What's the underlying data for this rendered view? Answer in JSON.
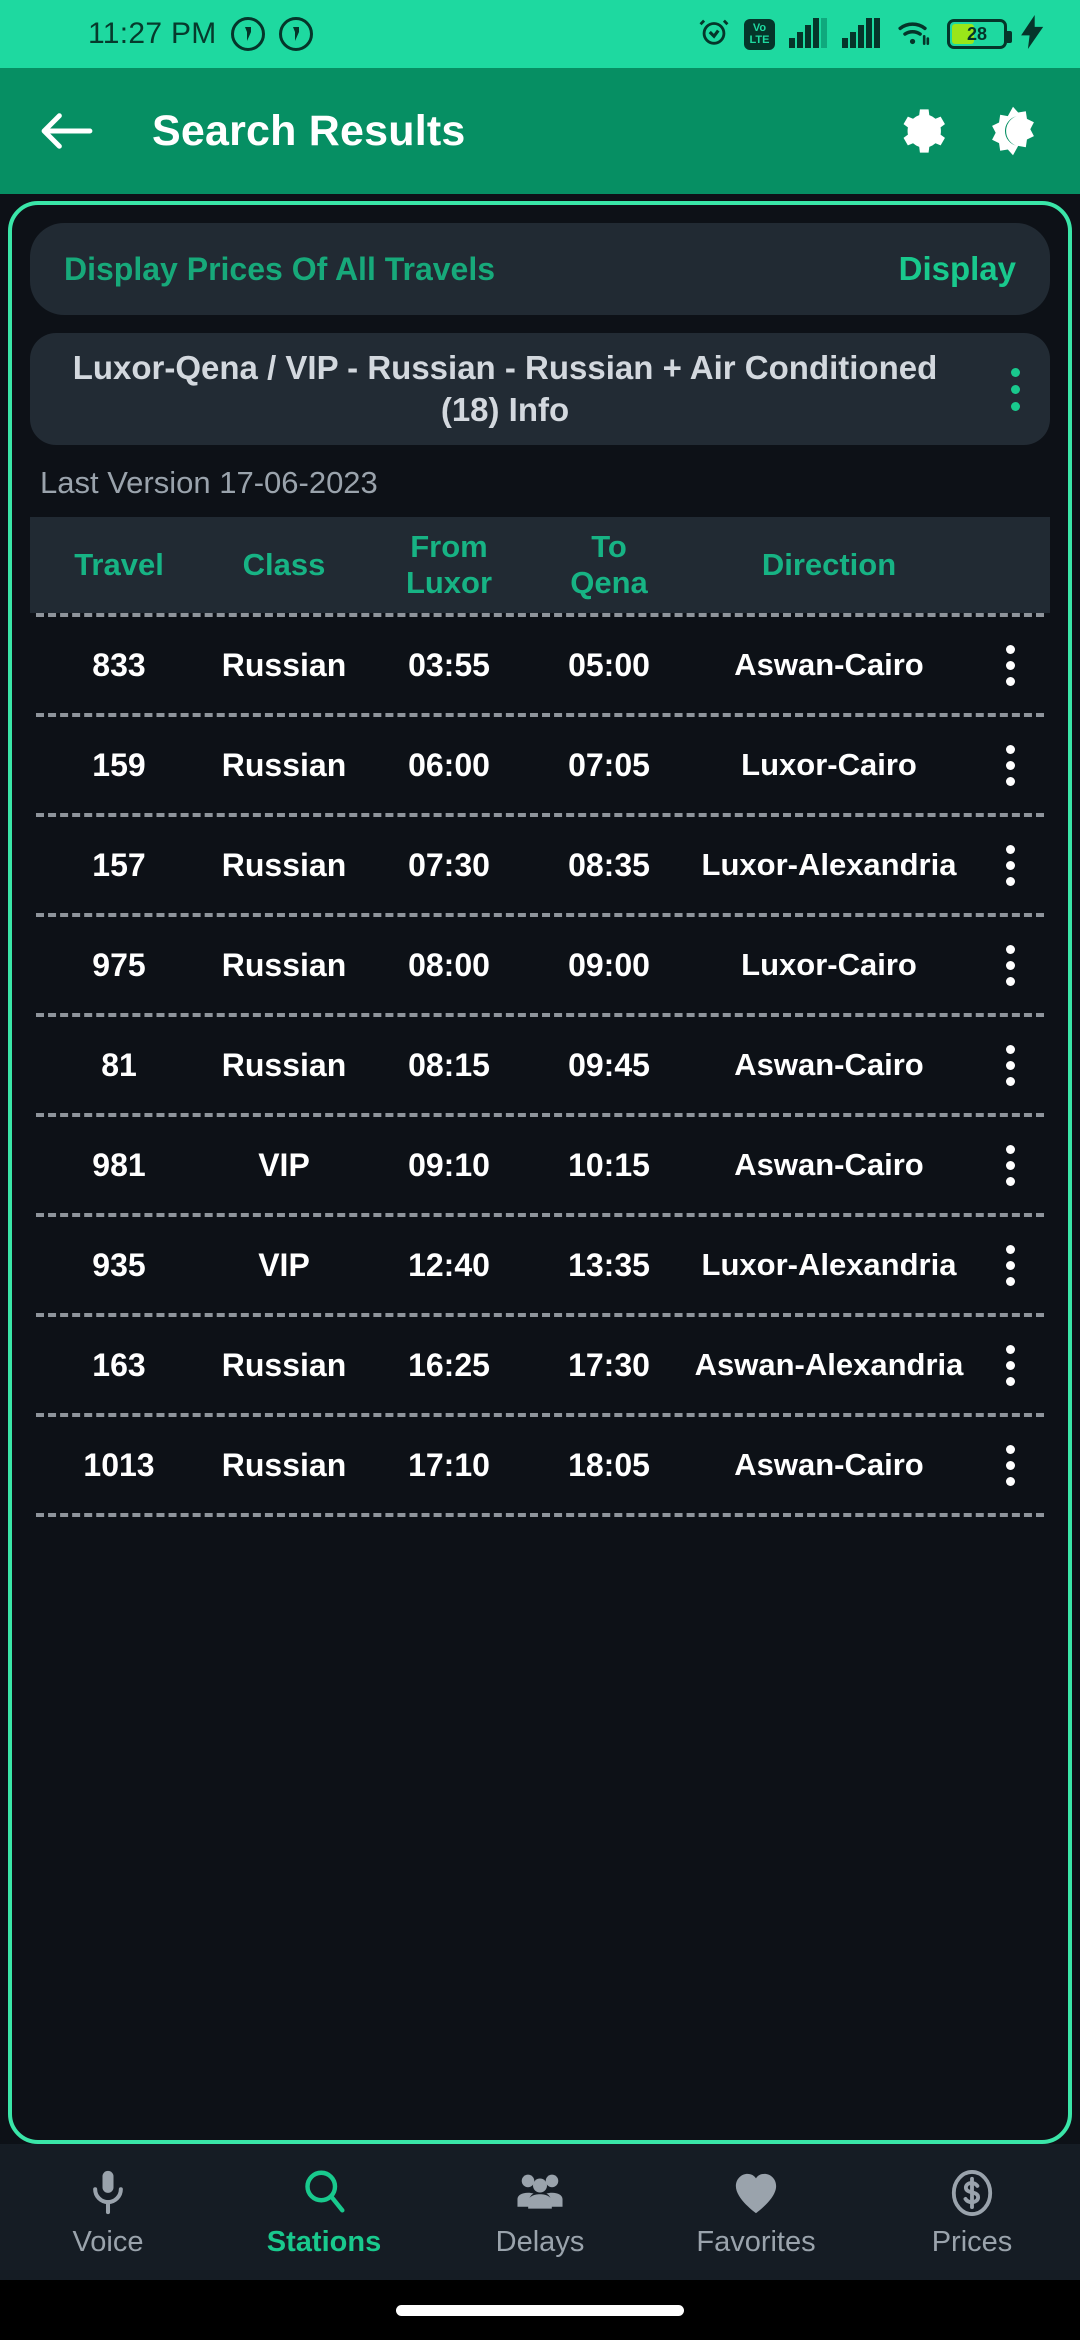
{
  "statusbar": {
    "time": "11:27 PM",
    "badge1": "icon-notification-1",
    "badge2": "icon-notification-2",
    "alarm_icon": "alarm-icon",
    "volte_top": "Vo",
    "volte_bottom": "LTE",
    "signal1_icon": "signal-bars-icon",
    "signal2_icon": "signal-bars-icon",
    "wifi_icon": "wifi-icon",
    "battery_level": "28",
    "charging_icon": "charging-bolt-icon"
  },
  "appbar": {
    "back_icon": "back-arrow-icon",
    "title": "Search Results",
    "settings_icon": "gear-icon",
    "theme_icon": "dark-mode-icon"
  },
  "prices_card": {
    "label": "Display Prices Of All Travels",
    "action": "Display"
  },
  "route_card": {
    "line1": "Luxor-Qena / VIP - Russian - Russian + Air Conditioned",
    "line2": "(18) Info",
    "overflow_icon": "more-vertical-icon"
  },
  "last_version": "Last Version 17-06-2023",
  "table": {
    "headers": {
      "travel": "Travel",
      "class": "Class",
      "from_l1": "From",
      "from_l2": "Luxor",
      "to_l1": "To",
      "to_l2": "Qena",
      "direction": "Direction"
    },
    "rows": [
      {
        "travel": "833",
        "class": "Russian",
        "from": "03:55",
        "to": "05:00",
        "direction": "Aswan-Cairo"
      },
      {
        "travel": "159",
        "class": "Russian",
        "from": "06:00",
        "to": "07:05",
        "direction": "Luxor-Cairo"
      },
      {
        "travel": "157",
        "class": "Russian",
        "from": "07:30",
        "to": "08:35",
        "direction": "Luxor-Alexandria"
      },
      {
        "travel": "975",
        "class": "Russian",
        "from": "08:00",
        "to": "09:00",
        "direction": "Luxor-Cairo"
      },
      {
        "travel": "81",
        "class": "Russian",
        "from": "08:15",
        "to": "09:45",
        "direction": "Aswan-Cairo"
      },
      {
        "travel": "981",
        "class": "VIP",
        "from": "09:10",
        "to": "10:15",
        "direction": "Aswan-Cairo"
      },
      {
        "travel": "935",
        "class": "VIP",
        "from": "12:40",
        "to": "13:35",
        "direction": "Luxor-Alexandria"
      },
      {
        "travel": "163",
        "class": "Russian",
        "from": "16:25",
        "to": "17:30",
        "direction": "Aswan-Alexandria"
      },
      {
        "travel": "1013",
        "class": "Russian",
        "from": "17:10",
        "to": "18:05",
        "direction": "Aswan-Cairo"
      }
    ],
    "row_menu_icon": "more-vertical-icon"
  },
  "bottom_nav": {
    "items": [
      {
        "label": "Voice",
        "icon": "microphone-icon",
        "active": false
      },
      {
        "label": "Stations",
        "icon": "search-icon",
        "active": true
      },
      {
        "label": "Delays",
        "icon": "people-icon",
        "active": false
      },
      {
        "label": "Favorites",
        "icon": "heart-icon",
        "active": false
      },
      {
        "label": "Prices",
        "icon": "dollar-icon",
        "active": false
      }
    ]
  },
  "colors": {
    "status_bar": "#1ed9a0",
    "app_bar": "#068f63",
    "accent": "#19c98d",
    "frame_border": "#3ae6a8",
    "background": "#0d1117",
    "card": "#212a33"
  }
}
